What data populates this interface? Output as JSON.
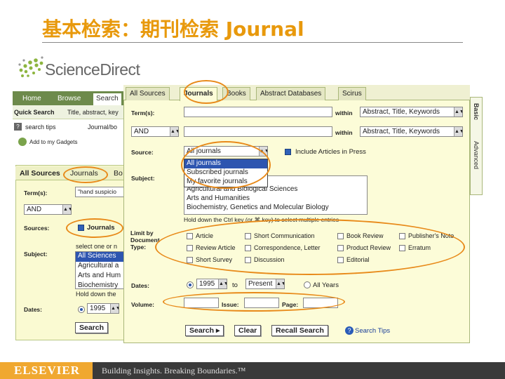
{
  "slide": {
    "title": "基本检索：期刊检索 Journal",
    "footer_brand": "ELSEVIER",
    "footer_tagline": "Building Insights. Breaking Boundaries.™"
  },
  "logo": {
    "text": "ScienceDirect"
  },
  "back": {
    "tabs": [
      "Home",
      "Browse",
      "Search"
    ],
    "quick_search": "Quick Search",
    "quick_search_hint": "Title, abstract, key",
    "search_tips": "search tips",
    "journal_book": "Journal/bo",
    "add_gadgets": "Add to my Gadgets",
    "panel_tabs": [
      "All Sources",
      "Journals",
      "Bo"
    ],
    "terms_label": "Term(s):",
    "terms_value": "\"hand suspicio",
    "connector": "AND",
    "sources_label": "Sources:",
    "journals_checkbox": "Journals",
    "select_hint": "select one or n",
    "subject_label": "Subject:",
    "subjects": [
      "All Sciences",
      "Agricultural a",
      "Arts and Hum",
      "Biochemistry"
    ],
    "hold_hint": "Hold down the",
    "dates_label": "Dates:",
    "year": "1995",
    "search_button": "Search"
  },
  "front": {
    "tabs": [
      "All Sources",
      "Journals",
      "Books",
      "Abstract Databases",
      "Scirus"
    ],
    "side_tab_top": "Basic",
    "side_tab_bottom": "Advanced",
    "term_label": "Term(s):",
    "within_label": "within",
    "within_value_1": "Abstract, Title, Keywords",
    "within_value_2": "Abstract, Title, Keywords",
    "connector": "AND",
    "source_label": "Source:",
    "source_value": "All journals",
    "source_options": [
      "All journals",
      "Subscribed journals",
      "My favorite journals"
    ],
    "include_press": "Include Articles in Press",
    "subject_label": "Subject:",
    "subjects": [
      "All Sciences",
      "Agricultural and Biological Sciences",
      "Arts and Humanities",
      "Biochemistry, Genetics and Molecular Biology"
    ],
    "hold_hint": "Hold down the Ctrl key (or ⌘ key) to select multiple entries",
    "limit_label": "Limit by Document Type:",
    "doc_types": [
      [
        "Article",
        "Short Communication",
        "Book Review",
        "Publisher's Note"
      ],
      [
        "Review Article",
        "Correspondence, Letter",
        "Product Review",
        "Erratum"
      ],
      [
        "Short Survey",
        "Discussion",
        "Editorial",
        ""
      ]
    ],
    "dates_label": "Dates:",
    "date_from": "1995",
    "to_label": "to",
    "date_to": "Present",
    "all_years": "All Years",
    "volume_label": "Volume:",
    "issue_label": "Issue:",
    "page_label": "Page:",
    "search_button": "Search ▸",
    "clear_button": "Clear",
    "recall_button": "Recall Search",
    "search_tips": "Search Tips"
  }
}
